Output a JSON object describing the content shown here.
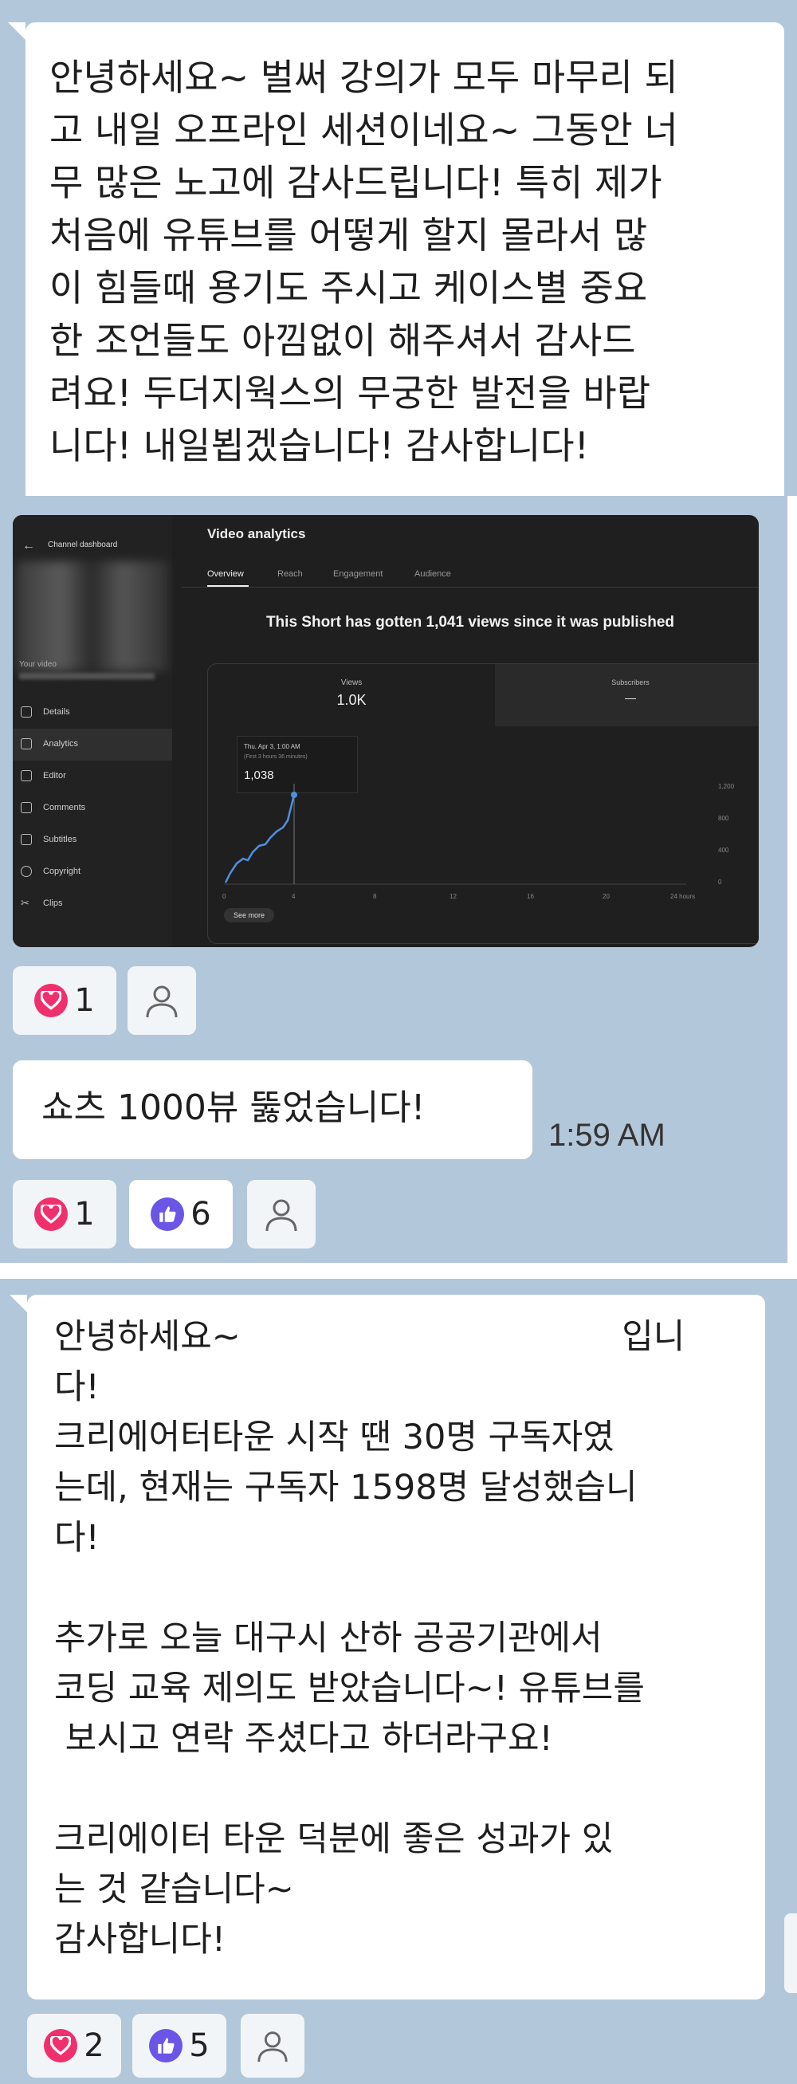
{
  "messages": [
    {
      "text": "안녕하세요~ 벌써 강의가 모두 마무리 되\n고 내일 오프라인 세션이네요~ 그동안 너\n무 많은 노고에 감사드립니다! 특히 제가\n처음에 유튜브를 어떻게 할지 몰라서 많\n이 힘들때 용기도 주시고 케이스별 중요\n한 조언들도 아낌없이 해주셔서 감사드\n려요! 두더지웍스의 무궁한 발전을 바랍\n니다! 내일뵙겠습니다! 감사합니다!"
    },
    {
      "text": "쇼츠 1000뷰 뚫었습니다!",
      "time": "1:59 AM"
    },
    {
      "text": "안녕하세요~                                   입니\n다!\n크리에어터타운 시작 땐 30명 구독자였\n는데, 현재는 구독자 1598명 달성했습니\n다!\n\n추가로 오늘 대구시 산하 공공기관에서\n코딩 교육 제의도 받았습니다~! 유튜브를\n 보시고 연락 주셨다고 하더라구요!\n\n크리에이터 타운 덕분에 좋은 성과가 있\n는 것 같습니다~\n감사합니다!"
    }
  ],
  "reactions": {
    "r1_heart": "1",
    "r2_heart": "1",
    "r2_like": "6",
    "r3_heart": "2",
    "r3_like": "5"
  },
  "analytics": {
    "back_label": "Channel dashboard",
    "page_title": "Video analytics",
    "tabs": [
      "Overview",
      "Reach",
      "Engagement",
      "Audience"
    ],
    "headline": "This Short has gotten 1,041 views since it was published",
    "views_label": "Views",
    "views_value": "1.0K",
    "subs_label": "Subscribers",
    "subs_value": "—",
    "tooltip_date": "Thu, Apr 3, 1:00 AM",
    "tooltip_sub": "(First 3 hours 36 minutes)",
    "tooltip_value": "1,038",
    "your_video": "Your video",
    "sidebar": [
      "Details",
      "Analytics",
      "Editor",
      "Comments",
      "Subtitles",
      "Copyright",
      "Clips"
    ],
    "x_ticks": [
      "0",
      "4",
      "8",
      "12",
      "16",
      "20",
      "24 hours"
    ],
    "y_ticks": [
      "1,200",
      "800",
      "400",
      "0"
    ],
    "see_more": "See more"
  },
  "colors": {
    "background": "#b2c7da",
    "heart": "#f0306d",
    "like": "#6a55e6"
  }
}
